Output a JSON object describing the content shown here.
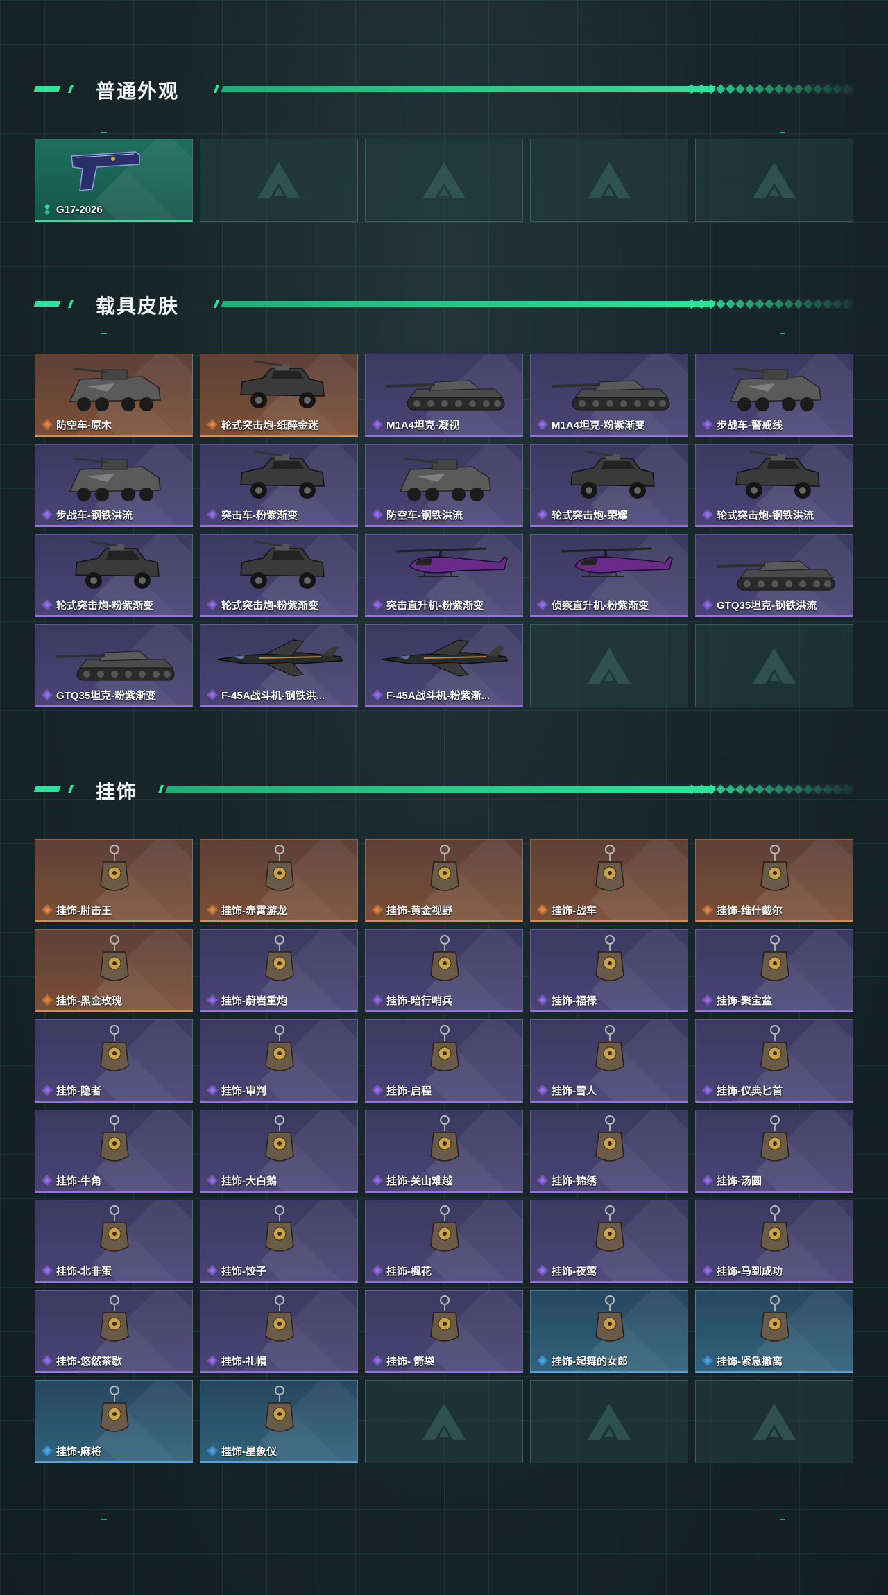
{
  "colors": {
    "accent": "#2fe39a",
    "rarity_green": "#2fe39a",
    "rarity_orange": "#e9883d",
    "rarity_purple": "#9b6cf0",
    "rarity_blue": "#4aa5ee"
  },
  "sections": {
    "appearance": {
      "title": "普通外观",
      "items": [
        {
          "label": "G17-2026",
          "rarity": "green",
          "icon": "pistol"
        },
        {
          "label": "",
          "rarity": "empty"
        },
        {
          "label": "",
          "rarity": "empty"
        },
        {
          "label": "",
          "rarity": "empty"
        },
        {
          "label": "",
          "rarity": "empty"
        }
      ]
    },
    "vehicles": {
      "title": "载具皮肤",
      "items": [
        {
          "label": "防空车-原木",
          "rarity": "orange",
          "icon": "apc"
        },
        {
          "label": "轮式突击炮-纸醉金迷",
          "rarity": "orange",
          "icon": "jeep"
        },
        {
          "label": "M1A4坦克-凝视",
          "rarity": "purple",
          "icon": "tank"
        },
        {
          "label": "M1A4坦克-粉紫渐变",
          "rarity": "purple",
          "icon": "tank"
        },
        {
          "label": "步战车-警戒线",
          "rarity": "purple",
          "icon": "apc"
        },
        {
          "label": "步战车-钢铁洪流",
          "rarity": "purple",
          "icon": "apc"
        },
        {
          "label": "突击车-粉紫渐变",
          "rarity": "purple",
          "icon": "jeep"
        },
        {
          "label": "防空车-钢铁洪流",
          "rarity": "purple",
          "icon": "apc"
        },
        {
          "label": "轮式突击炮-荣耀",
          "rarity": "purple",
          "icon": "jeep"
        },
        {
          "label": "轮式突击炮-钢铁洪流",
          "rarity": "purple",
          "icon": "jeep"
        },
        {
          "label": "轮式突击炮-粉紫渐变",
          "rarity": "purple",
          "icon": "jeep"
        },
        {
          "label": "轮式突击炮-粉紫渐变",
          "rarity": "purple",
          "icon": "jeep"
        },
        {
          "label": "突击直升机-粉紫渐变",
          "rarity": "purple",
          "icon": "helicopter"
        },
        {
          "label": "侦察直升机-粉紫渐变",
          "rarity": "purple",
          "icon": "helicopter"
        },
        {
          "label": "GTQ35坦克-钢铁洪流",
          "rarity": "purple",
          "icon": "tank"
        },
        {
          "label": "GTQ35坦克-粉紫渐变",
          "rarity": "purple",
          "icon": "tank"
        },
        {
          "label": "F-45A战斗机-钢铁洪...",
          "rarity": "purple",
          "icon": "jet"
        },
        {
          "label": "F-45A战斗机-粉紫渐...",
          "rarity": "purple",
          "icon": "jet"
        },
        {
          "label": "",
          "rarity": "empty"
        },
        {
          "label": "",
          "rarity": "empty"
        }
      ]
    },
    "charms": {
      "title": "挂饰",
      "items": [
        {
          "label": "挂饰-肘击王",
          "rarity": "orange",
          "icon": "charm"
        },
        {
          "label": "挂饰-赤霄游龙",
          "rarity": "orange",
          "icon": "charm"
        },
        {
          "label": "挂饰-黄金视野",
          "rarity": "orange",
          "icon": "charm"
        },
        {
          "label": "挂饰-战车",
          "rarity": "orange",
          "icon": "charm"
        },
        {
          "label": "挂饰-维什戴尔",
          "rarity": "orange",
          "icon": "charm"
        },
        {
          "label": "挂饰-黑金玫瑰",
          "rarity": "orange",
          "icon": "charm"
        },
        {
          "label": "挂饰-蔚岩重炮",
          "rarity": "purple",
          "icon": "charm"
        },
        {
          "label": "挂饰-暗行哨兵",
          "rarity": "purple",
          "icon": "charm"
        },
        {
          "label": "挂饰-福禄",
          "rarity": "purple",
          "icon": "charm"
        },
        {
          "label": "挂饰-聚宝盆",
          "rarity": "purple",
          "icon": "charm"
        },
        {
          "label": "挂饰-隐者",
          "rarity": "purple",
          "icon": "charm"
        },
        {
          "label": "挂饰-审判",
          "rarity": "purple",
          "icon": "charm"
        },
        {
          "label": "挂饰-启程",
          "rarity": "purple",
          "icon": "charm"
        },
        {
          "label": "挂饰-雪人",
          "rarity": "purple",
          "icon": "charm"
        },
        {
          "label": "挂饰-仪典匕首",
          "rarity": "purple",
          "icon": "charm"
        },
        {
          "label": "挂饰-牛角",
          "rarity": "purple",
          "icon": "charm"
        },
        {
          "label": "挂饰-大白鹅",
          "rarity": "purple",
          "icon": "charm"
        },
        {
          "label": "挂饰-关山难越",
          "rarity": "purple",
          "icon": "charm"
        },
        {
          "label": "挂饰-锦绣",
          "rarity": "purple",
          "icon": "charm"
        },
        {
          "label": "挂饰-汤圆",
          "rarity": "purple",
          "icon": "charm"
        },
        {
          "label": "挂饰-北非蛋",
          "rarity": "purple",
          "icon": "charm"
        },
        {
          "label": "挂饰-饺子",
          "rarity": "purple",
          "icon": "charm"
        },
        {
          "label": "挂饰-楓花",
          "rarity": "purple",
          "icon": "charm"
        },
        {
          "label": "挂饰-夜莺",
          "rarity": "purple",
          "icon": "charm"
        },
        {
          "label": "挂饰-马到成功",
          "rarity": "purple",
          "icon": "charm"
        },
        {
          "label": "挂饰-悠然茶歇",
          "rarity": "purple",
          "icon": "charm"
        },
        {
          "label": "挂饰-礼帽",
          "rarity": "purple",
          "icon": "charm"
        },
        {
          "label": "挂饰- 箭袋",
          "rarity": "purple",
          "icon": "charm"
        },
        {
          "label": "挂饰-起舞的女郎",
          "rarity": "blue",
          "icon": "charm"
        },
        {
          "label": "挂饰-紧急撤离",
          "rarity": "blue",
          "icon": "charm"
        },
        {
          "label": "挂饰-麻将",
          "rarity": "blue",
          "icon": "charm"
        },
        {
          "label": "挂饰-星象仪",
          "rarity": "blue",
          "icon": "charm"
        },
        {
          "label": "",
          "rarity": "empty"
        },
        {
          "label": "",
          "rarity": "empty"
        },
        {
          "label": "",
          "rarity": "empty"
        }
      ]
    }
  }
}
